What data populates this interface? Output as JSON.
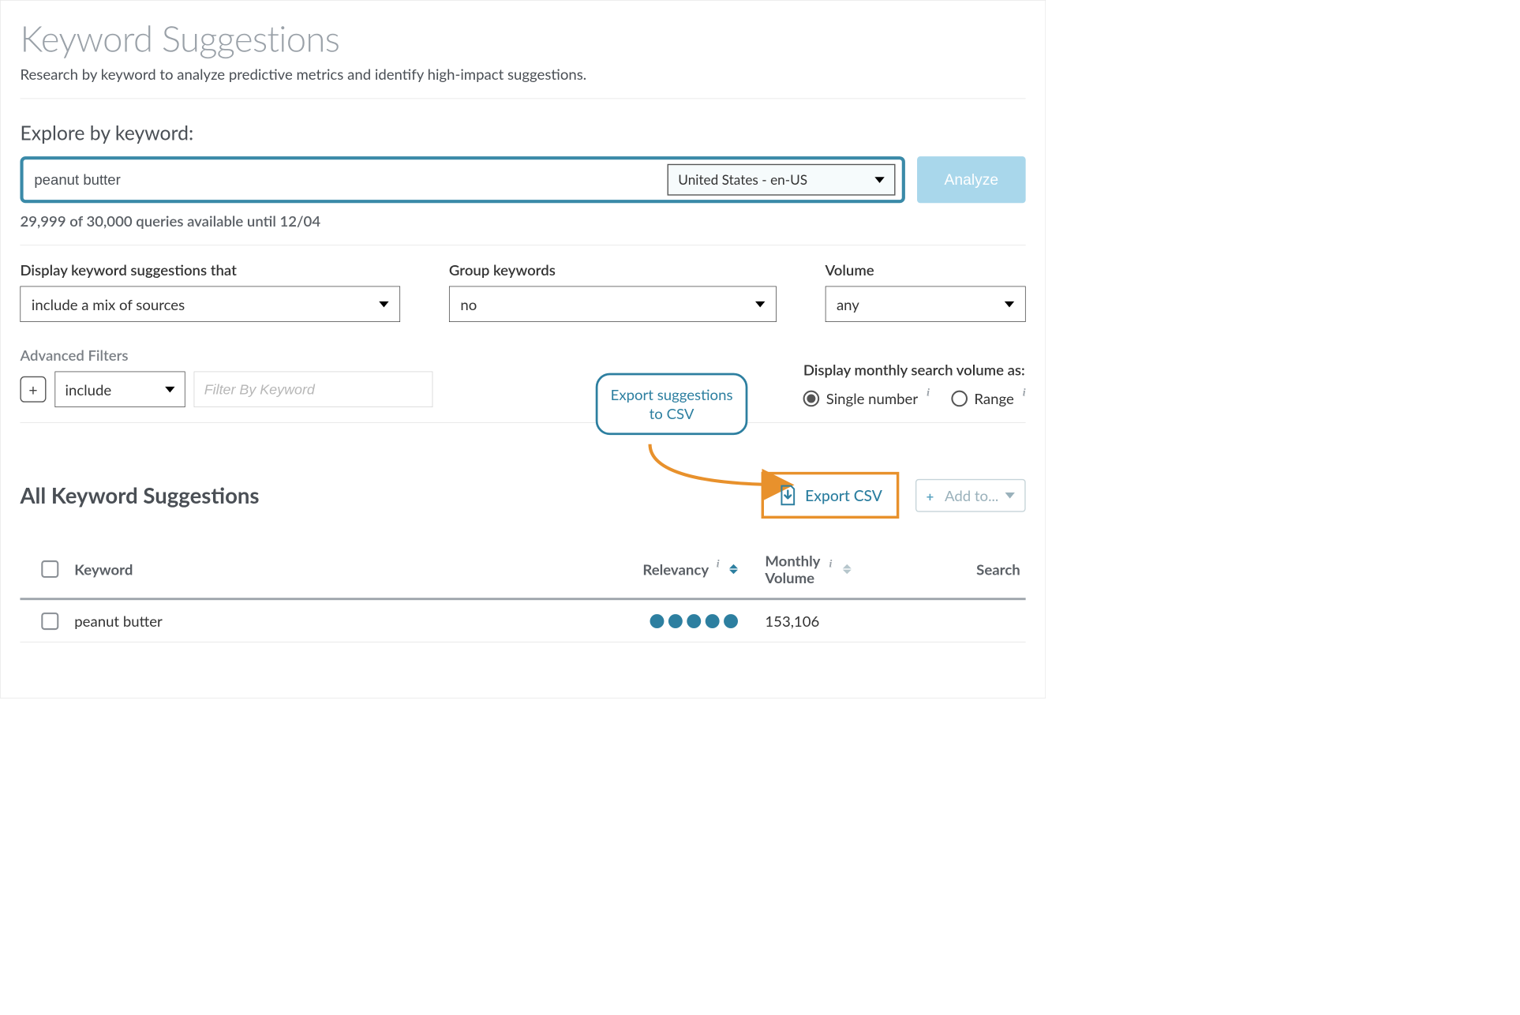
{
  "page": {
    "title": "Keyword Suggestions",
    "subtitle": "Research by keyword to analyze predictive metrics and identify high-impact suggestions.",
    "explore_label": "Explore by keyword:"
  },
  "search": {
    "value": "peanut butter",
    "locale": "United States - en-US",
    "analyze_label": "Analyze",
    "quota": "29,999 of 30,000 queries available until 12/04"
  },
  "filters": {
    "display_label": "Display keyword suggestions that",
    "display_value": "include a mix of sources",
    "group_label": "Group keywords",
    "group_value": "no",
    "volume_label": "Volume",
    "volume_value": "any"
  },
  "advanced": {
    "label": "Advanced Filters",
    "include_value": "include",
    "filter_placeholder": "Filter By Keyword"
  },
  "volume_as": {
    "label": "Display monthly search volume as:",
    "single": "Single number",
    "range": "Range",
    "selected": "single"
  },
  "callout": {
    "text": "Export suggestions to CSV"
  },
  "results": {
    "title": "All Keyword Suggestions",
    "export_label": "Export CSV",
    "addto_label": "Add to..."
  },
  "table": {
    "headers": {
      "keyword": "Keyword",
      "relevancy": "Relevancy",
      "monthly_volume": "Monthly Volume",
      "search": "Search"
    },
    "rows": [
      {
        "keyword": "peanut butter",
        "relevancy_dots": 5,
        "monthly_volume": "153,106"
      }
    ]
  }
}
